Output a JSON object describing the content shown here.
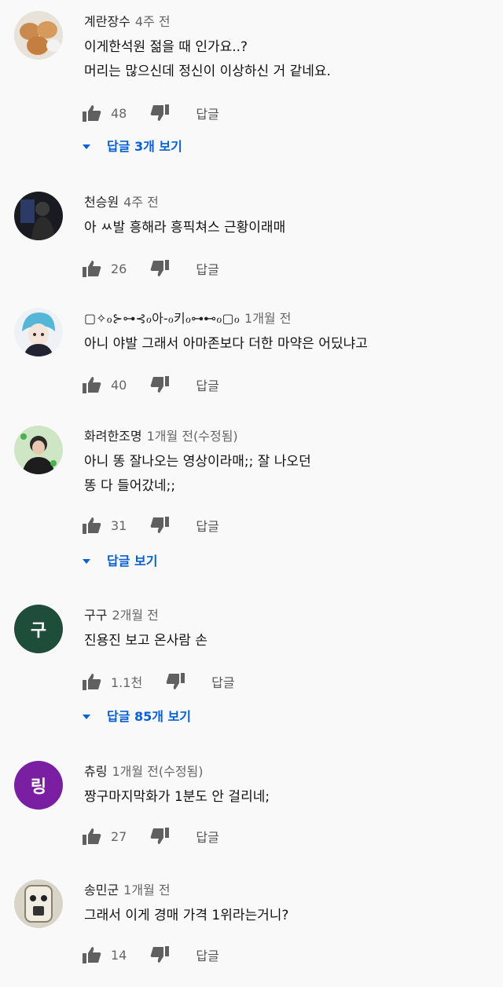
{
  "comments": [
    {
      "author": "계란장수",
      "time": "4주 전",
      "lines": [
        "이게한석원 젊을 때 인가요..?",
        "머리는 많으신데 정신이 이상하신 거 같네요."
      ],
      "likes": "48",
      "reply": "답글",
      "replies": "답글 3개 보기",
      "avatar": "eggs"
    },
    {
      "author": "천승원",
      "time": "4주 전",
      "lines": [
        "아 ㅆ발 흥해라 흥픽쳐스 근황이래매"
      ],
      "likes": "26",
      "reply": "답글",
      "avatar": "dark-figure"
    },
    {
      "author": "▢✧ℴ⊱⊶⊰ℴ아-ℴ키ℴ⊶⊷ℴ▢ℴ",
      "time": "1개월 전",
      "lines": [
        "아니 야발 그래서 아마존보다 더한 마약은 어딨냐고"
      ],
      "likes": "40",
      "reply": "답글",
      "avatar": "anime"
    },
    {
      "author": "화려한조명",
      "time": "1개월 전(수정됨)",
      "lines": [
        "아니 똥 잘나오는 영상이라매;; 잘 나오던",
        "똥 다 들어갔네;;"
      ],
      "likes": "31",
      "reply": "답글",
      "replies": "답글 보기",
      "avatar": "portrait"
    },
    {
      "author": "구구",
      "time": "2개월 전",
      "lines": [
        "진용진 보고 온사람 손"
      ],
      "likes": "1.1천",
      "reply": "답글",
      "replies": "답글 85개 보기",
      "avatar_letter": "구",
      "avatar_color": "#1e4d3a"
    },
    {
      "author": "츄링",
      "time": "1개월 전(수정됨)",
      "lines": [
        "짱구마지막화가 1분도 안 걸리네;"
      ],
      "likes": "27",
      "reply": "답글",
      "avatar_letter": "링",
      "avatar_color": "#7b1fa2"
    },
    {
      "author": "송민군",
      "time": "1개월 전",
      "lines": [
        "그래서 이게 경매 가격 1위라는거니?"
      ],
      "likes": "14",
      "reply": "답글",
      "avatar": "face"
    }
  ]
}
